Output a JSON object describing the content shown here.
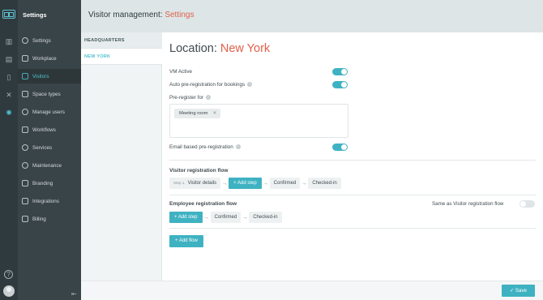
{
  "nav": {
    "title": "Settings",
    "items": [
      {
        "label": "Settings",
        "icon": "gear-icon"
      },
      {
        "label": "Workplace",
        "icon": "building-icon"
      },
      {
        "label": "Visitors",
        "icon": "visitor-icon"
      },
      {
        "label": "Space types",
        "icon": "space-types-icon"
      },
      {
        "label": "Manage users",
        "icon": "users-icon"
      },
      {
        "label": "Workflows",
        "icon": "workflow-icon"
      },
      {
        "label": "Services",
        "icon": "services-icon"
      },
      {
        "label": "Maintenance",
        "icon": "maintenance-icon"
      },
      {
        "label": "Branding",
        "icon": "branding-icon"
      },
      {
        "label": "Integrations",
        "icon": "integrations-icon"
      },
      {
        "label": "Billing",
        "icon": "billing-icon"
      }
    ],
    "active": "Visitors"
  },
  "header": {
    "prefix": "Visitor management: ",
    "accent": "Settings"
  },
  "locations": {
    "items": [
      "HEADQUARTERS",
      "NEW YORK"
    ],
    "selected": "NEW YORK"
  },
  "main": {
    "title_prefix": "Location: ",
    "title_accent": "New York",
    "vm_active_label": "VM Active",
    "auto_prereg_label": "Auto pre-registration for bookings",
    "prereg_for_label": "Pre-register for",
    "prereg_chip": "Meeting room",
    "email_prereg_label": "Email based pre-registration",
    "visitor_flow": {
      "title": "Visitor registration flow",
      "step1_prefix": "Step 1.",
      "step1_label": "Visitor details",
      "add_step": "+ Add step",
      "confirmed": "Confirmed",
      "checked_in": "Checked-in"
    },
    "employee_flow": {
      "title": "Employee registration flow",
      "same_as_label": "Same as Visitor registration flow",
      "add_step": "+ Add step",
      "confirmed": "Confirmed",
      "checked_in": "Checked-in"
    },
    "add_flow": "+ Add flow"
  },
  "toggles": {
    "vm_active": true,
    "auto_prereg": true,
    "email_prereg": true,
    "same_as_visitor": false
  },
  "footer": {
    "save_label": "✓  Save"
  },
  "colors": {
    "accent": "#3fb2c2",
    "title_accent": "#e0614c",
    "sidebar": "#394448"
  }
}
